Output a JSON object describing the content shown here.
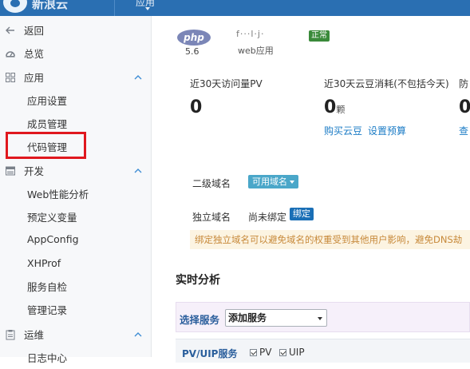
{
  "topbar": {
    "brand": "新浪云",
    "app_select": "应用"
  },
  "sidebar": {
    "back": "返回",
    "overview": "总览",
    "app_group": "应用",
    "app_items": [
      "应用设置",
      "成员管理",
      "代码管理"
    ],
    "dev_group": "开发",
    "dev_items": [
      "Web性能分析",
      "预定义变量",
      "AppConfig",
      "XHProf",
      "服务自检",
      "管理记录"
    ],
    "ops_group": "运维",
    "ops_items": [
      "日志中心"
    ],
    "highlighted_item": "代码管理",
    "highlight_color": "#e0181e"
  },
  "app_header": {
    "runtime_logo": "php",
    "runtime_version": "5.6",
    "app_name": "f···l·j·",
    "app_type": "web应用",
    "status": "正常"
  },
  "stats": {
    "pv_label": "近30天访问量PV",
    "pv_value": "0",
    "cloud_bean_label": "近30天云豆消耗(不包括今天)",
    "cloud_bean_value": "0",
    "cloud_bean_unit": "颗",
    "buy_link": "购买云豆",
    "budget_link": "设置预算",
    "third_label": "防",
    "third_value": "0",
    "third_link": "查"
  },
  "domains": {
    "subdomain_label": "二级域名",
    "subdomain_button": "可用域名",
    "custom_label": "独立域名",
    "custom_state": "尚未绑定",
    "bind_button": "绑定",
    "notice": "绑定独立域名可以避免域名的权重受到其他用户影响，避免DNS劫"
  },
  "realtime": {
    "title": "实时分析",
    "service_label": "选择服务",
    "service_select": "添加服务",
    "pv_title": "PV/UIP服务",
    "checkbox_pv": "PV",
    "checkbox_uip": "UIP"
  },
  "colors": {
    "topbar": "#2a6fb2",
    "link": "#1c7cc6",
    "status_badge": "#3a8a3a",
    "notice_bg": "#fcf4e2"
  }
}
